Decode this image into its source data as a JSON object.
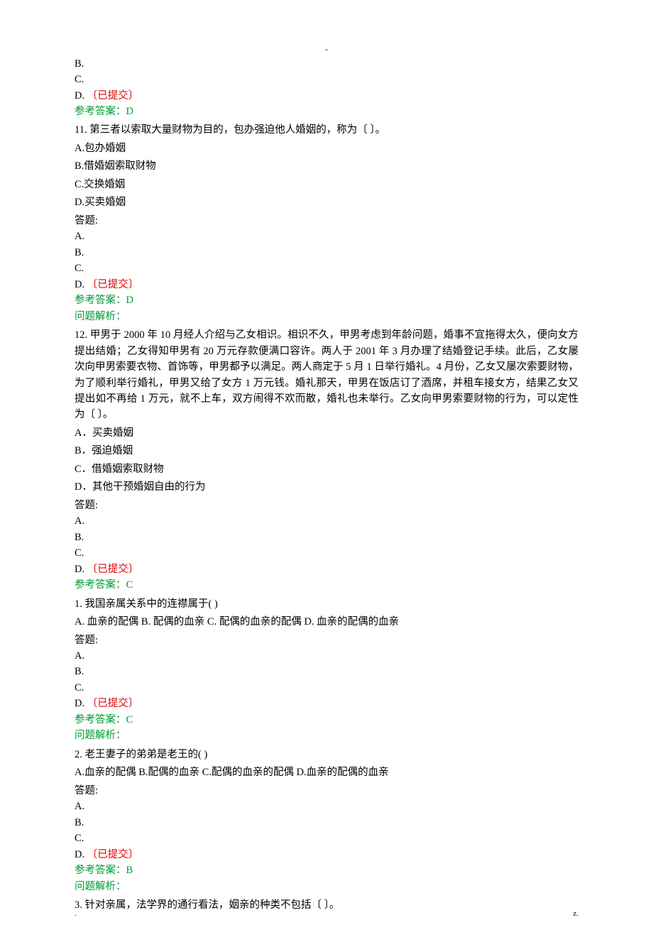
{
  "top_marker": "-",
  "prev_tail": {
    "b": "B.",
    "c": "C.",
    "d_prefix": "D.   ",
    "d_submitted": "〔已提交〕",
    "ref": "参考答案：D"
  },
  "q11": {
    "num_text": "11. 第三者以索取大量财物为目的，包办强迫他人婚姻的，称为〔 〕。",
    "a": " A.包办婚姻",
    "b": " B.借婚姻索取财物",
    "c": " C.交换婚姻",
    "d": " D.买卖婚姻",
    "ans_label": "答题:",
    "oa": "A.",
    "ob": "B.",
    "oc": "C.",
    "od_prefix": "D.   ",
    "od_submitted": "〔已提交〕",
    "ref": "参考答案：D",
    "analysis": "问题解析："
  },
  "q12": {
    "num_text": "12. 甲男于 2000 年 10 月经人介绍与乙女相识。相识不久，甲男考虑到年龄问题，婚事不宜拖得太久，便向女方提出结婚；乙女得知甲男有 20 万元存款便满口容许。两人于 2001 年 3 月办理了结婚登记手续。此后，乙女屡次向甲男索要衣物、首饰等，甲男都予以满足。两人商定于 5 月 1 日举行婚礼。4 月份，乙女又屡次索要财物，为了顺利举行婚礼，甲男又给了女方 1 万元钱。婚礼那天，甲男在饭店订了酒席，并租车接女方，结果乙女又提出如不再给 1 万元，就不上车，双方闹得不欢而散，婚礼也未举行。乙女向甲男索要财物的行为，可以定性为〔 〕。",
    "a": " A．买卖婚姻",
    "b": " B．强迫婚姻",
    "c": " C．借婚姻索取财物",
    "d": " D．其他干预婚姻自由的行为",
    "ans_label": "答题:",
    "oa": "A.",
    "ob": "B.",
    "oc": "C.",
    "od_prefix": "D.   ",
    "od_submitted": "〔已提交〕",
    "ref": "参考答案：C"
  },
  "q1": {
    "num_text": "1. 我国亲属关系中的连襟属于( )",
    "opts": " A. 血亲的配偶 B. 配偶的血亲 C. 配偶的血亲的配偶 D. 血亲的配偶的血亲",
    "ans_label": "答题:",
    "oa": "A.",
    "ob": "B.",
    "oc": "C.",
    "od_prefix": "D.   ",
    "od_submitted": "〔已提交〕",
    "ref": "参考答案：C",
    "analysis": "问题解析："
  },
  "q2": {
    "num_text": "2. 老王妻子的弟弟是老王的( )",
    "opts": " A.血亲的配偶 B.配偶的血亲 C.配偶的血亲的配偶 D.血亲的配偶的血亲",
    "ans_label": "答题:",
    "oa": "A.",
    "ob": "B.",
    "oc": "C.",
    "od_prefix": "D.   ",
    "od_submitted": "〔已提交〕",
    "ref": "参考答案：B",
    "analysis": "问题解析："
  },
  "q3": {
    "num_text": "3. 针对亲属，法学界的通行看法，姻亲的种类不包括〔 〕。"
  },
  "footer": {
    "left": ".",
    "right": "z."
  }
}
